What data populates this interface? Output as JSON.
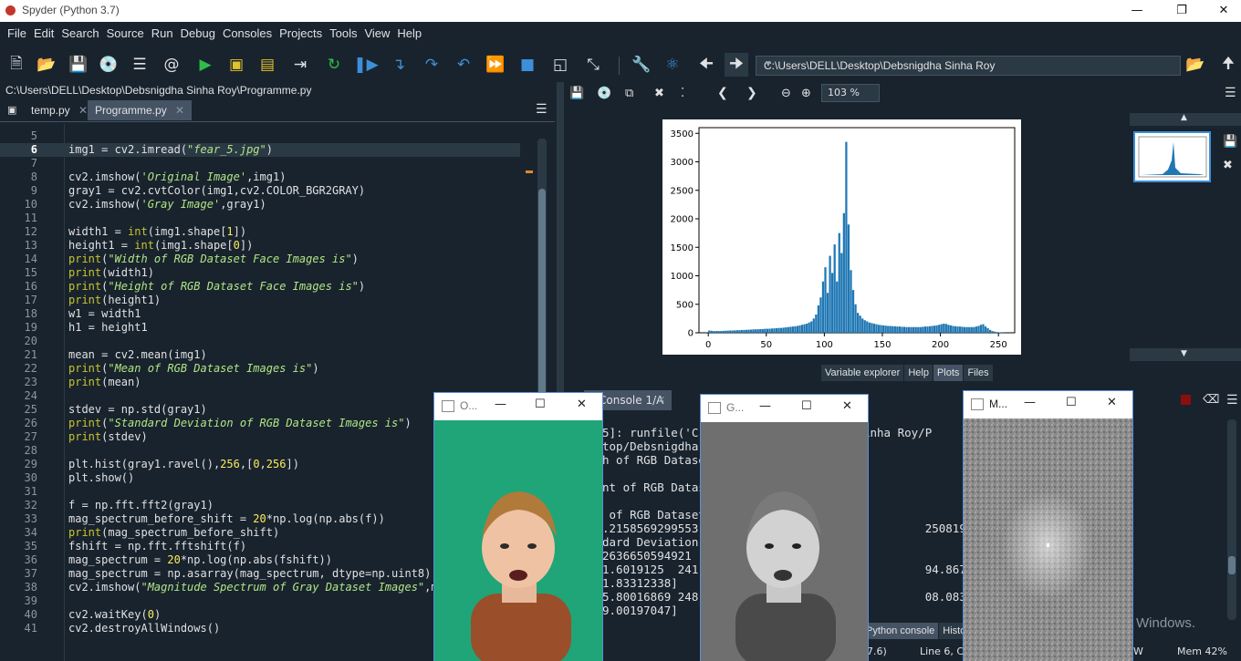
{
  "window": {
    "title": "Spyder (Python 3.7)",
    "minimize_icon": "minimize-icon",
    "maximize_icon": "restore-icon",
    "close_icon": "close-icon"
  },
  "menu": [
    "File",
    "Edit",
    "Search",
    "Source",
    "Run",
    "Debug",
    "Consoles",
    "Projects",
    "Tools",
    "View",
    "Help"
  ],
  "toolbar": {
    "working_dir": "C:\\Users\\DELL\\Desktop\\Debsnigdha Sinha Roy"
  },
  "editor": {
    "file_path": "C:\\Users\\DELL\\Desktop\\Debsnigdha Sinha Roy\\Programme.py",
    "tabs": [
      {
        "label": "temp.py",
        "active": false
      },
      {
        "label": "Programme.py",
        "active": true
      }
    ],
    "current_line": 6,
    "lines": [
      {
        "n": "5",
        "code": ""
      },
      {
        "n": "6",
        "code": "img1 = cv2.imread(\"fear_5.jpg\")"
      },
      {
        "n": "7",
        "code": ""
      },
      {
        "n": "8",
        "code": "cv2.imshow('Original Image',img1)"
      },
      {
        "n": "9",
        "code": "gray1 = cv2.cvtColor(img1,cv2.COLOR_BGR2GRAY)"
      },
      {
        "n": "10",
        "code": "cv2.imshow('Gray Image',gray1)"
      },
      {
        "n": "11",
        "code": ""
      },
      {
        "n": "12",
        "code": "width1 = int(img1.shape[1])"
      },
      {
        "n": "13",
        "code": "height1 = int(img1.shape[0])"
      },
      {
        "n": "14",
        "code": "print(\"Width of RGB Dataset Face Images is\")"
      },
      {
        "n": "15",
        "code": "print(width1)"
      },
      {
        "n": "16",
        "code": "print(\"Height of RGB Dataset Face Images is\")"
      },
      {
        "n": "17",
        "code": "print(height1)"
      },
      {
        "n": "18",
        "code": "w1 = width1"
      },
      {
        "n": "19",
        "code": "h1 = height1"
      },
      {
        "n": "20",
        "code": ""
      },
      {
        "n": "21",
        "code": "mean = cv2.mean(img1)"
      },
      {
        "n": "22",
        "code": "print(\"Mean of RGB Dataset Images is\")"
      },
      {
        "n": "23",
        "code": "print(mean)"
      },
      {
        "n": "24",
        "code": ""
      },
      {
        "n": "25",
        "code": "stdev = np.std(gray1)"
      },
      {
        "n": "26",
        "code": "print(\"Standard Deviation of RGB Dataset Images is\")"
      },
      {
        "n": "27",
        "code": "print(stdev)"
      },
      {
        "n": "28",
        "code": ""
      },
      {
        "n": "29",
        "code": "plt.hist(gray1.ravel(),256,[0,256])"
      },
      {
        "n": "30",
        "code": "plt.show()"
      },
      {
        "n": "31",
        "code": ""
      },
      {
        "n": "32",
        "code": "f = np.fft.fft2(gray1)"
      },
      {
        "n": "33",
        "code": "mag_spectrum_before_shift = 20*np.log(np.abs(f))"
      },
      {
        "n": "34",
        "code": "print(mag_spectrum_before_shift)"
      },
      {
        "n": "35",
        "code": "fshift = np.fft.fftshift(f)"
      },
      {
        "n": "36",
        "code": "mag_spectrum = 20*np.log(np.abs(fshift))"
      },
      {
        "n": "37",
        "code": "mag_spectrum = np.asarray(mag_spectrum, dtype=np.uint8)"
      },
      {
        "n": "38",
        "code": "cv2.imshow(\"Magnitude Spectrum of Gray Dataset Images\",ma"
      },
      {
        "n": "39",
        "code": ""
      },
      {
        "n": "40",
        "code": "cv2.waitKey(0)"
      },
      {
        "n": "41",
        "code": "cv2.destroyAllWindows()"
      }
    ]
  },
  "plots": {
    "zoom": "103 %",
    "pane_tabs": [
      "Variable explorer",
      "Help",
      "Plots",
      "Files"
    ],
    "active_tab": "Plots"
  },
  "chart_data": {
    "type": "bar",
    "title": "",
    "xlabel": "",
    "ylabel": "",
    "xlim": [
      -8,
      264
    ],
    "ylim": [
      0,
      3600
    ],
    "xticks": [
      0,
      50,
      100,
      150,
      200,
      250
    ],
    "yticks": [
      0,
      500,
      1000,
      1500,
      2000,
      2500,
      3000,
      3500
    ],
    "bar_color": "#1f77b4",
    "x": [
      0,
      2,
      4,
      6,
      8,
      10,
      12,
      14,
      16,
      18,
      20,
      22,
      24,
      26,
      28,
      30,
      32,
      34,
      36,
      38,
      40,
      42,
      44,
      46,
      48,
      50,
      52,
      54,
      56,
      58,
      60,
      62,
      64,
      66,
      68,
      70,
      72,
      74,
      76,
      78,
      80,
      82,
      84,
      86,
      88,
      90,
      92,
      94,
      96,
      98,
      100,
      102,
      104,
      106,
      108,
      110,
      112,
      114,
      116,
      118,
      120,
      122,
      124,
      126,
      128,
      130,
      132,
      134,
      136,
      138,
      140,
      142,
      144,
      146,
      148,
      150,
      152,
      154,
      156,
      158,
      160,
      162,
      164,
      166,
      168,
      170,
      172,
      174,
      176,
      178,
      180,
      182,
      184,
      186,
      188,
      190,
      192,
      194,
      196,
      198,
      200,
      202,
      204,
      206,
      208,
      210,
      212,
      214,
      216,
      218,
      220,
      222,
      224,
      226,
      228,
      230,
      232,
      234,
      236,
      238,
      240,
      242,
      244,
      246,
      248,
      250,
      252,
      254
    ],
    "values": [
      40,
      35,
      30,
      30,
      32,
      30,
      35,
      35,
      38,
      40,
      40,
      42,
      45,
      45,
      48,
      50,
      52,
      55,
      55,
      60,
      60,
      62,
      65,
      65,
      70,
      70,
      72,
      75,
      78,
      80,
      85,
      85,
      90,
      95,
      100,
      105,
      110,
      115,
      120,
      130,
      140,
      150,
      160,
      180,
      200,
      250,
      320,
      480,
      620,
      900,
      1150,
      700,
      1350,
      1050,
      1550,
      900,
      1750,
      1400,
      2100,
      3350,
      1900,
      1100,
      750,
      500,
      350,
      300,
      250,
      220,
      200,
      180,
      170,
      160,
      150,
      140,
      135,
      130,
      125,
      120,
      120,
      115,
      115,
      110,
      110,
      105,
      105,
      100,
      100,
      100,
      100,
      100,
      100,
      100,
      105,
      110,
      110,
      115,
      120,
      125,
      130,
      140,
      150,
      160,
      155,
      140,
      130,
      120,
      115,
      110,
      110,
      105,
      100,
      100,
      100,
      100,
      100,
      110,
      120,
      140,
      150,
      110,
      80,
      50,
      30,
      20,
      12,
      8,
      5,
      3
    ]
  },
  "console": {
    "tab_label": "Console 1/A",
    "lines": [
      "5]: runfile('C:/                 dha Sinha Roy/P                   rs/DELL/",
      "top/Debsnigdha S",
      "h of RGB Dataset",
      "",
      "nt of RGB Datase",
      "",
      " of RGB Dataset",
      ".2158569299553,                                250819672131, 0.",
      "dard Deviation o",
      "2636650594921",
      "1.6019125  241.8                               94.86776112 235",
      "1.83312338]",
      "5.80016869 248.8                               08.08321867 243",
      "9.00197047]"
    ],
    "bottom_tabs": [
      "IPython console",
      "History"
    ],
    "watermark": "Windows.",
    "status": {
      "python": "7.6)",
      "line_col": "Line 6, Co",
      "eol": "W",
      "mem": "Mem 42%"
    }
  },
  "floating_windows": [
    {
      "title": "O...",
      "kind": "original"
    },
    {
      "title": "G...",
      "kind": "gray"
    },
    {
      "title": "M...",
      "kind": "magnitude"
    }
  ]
}
